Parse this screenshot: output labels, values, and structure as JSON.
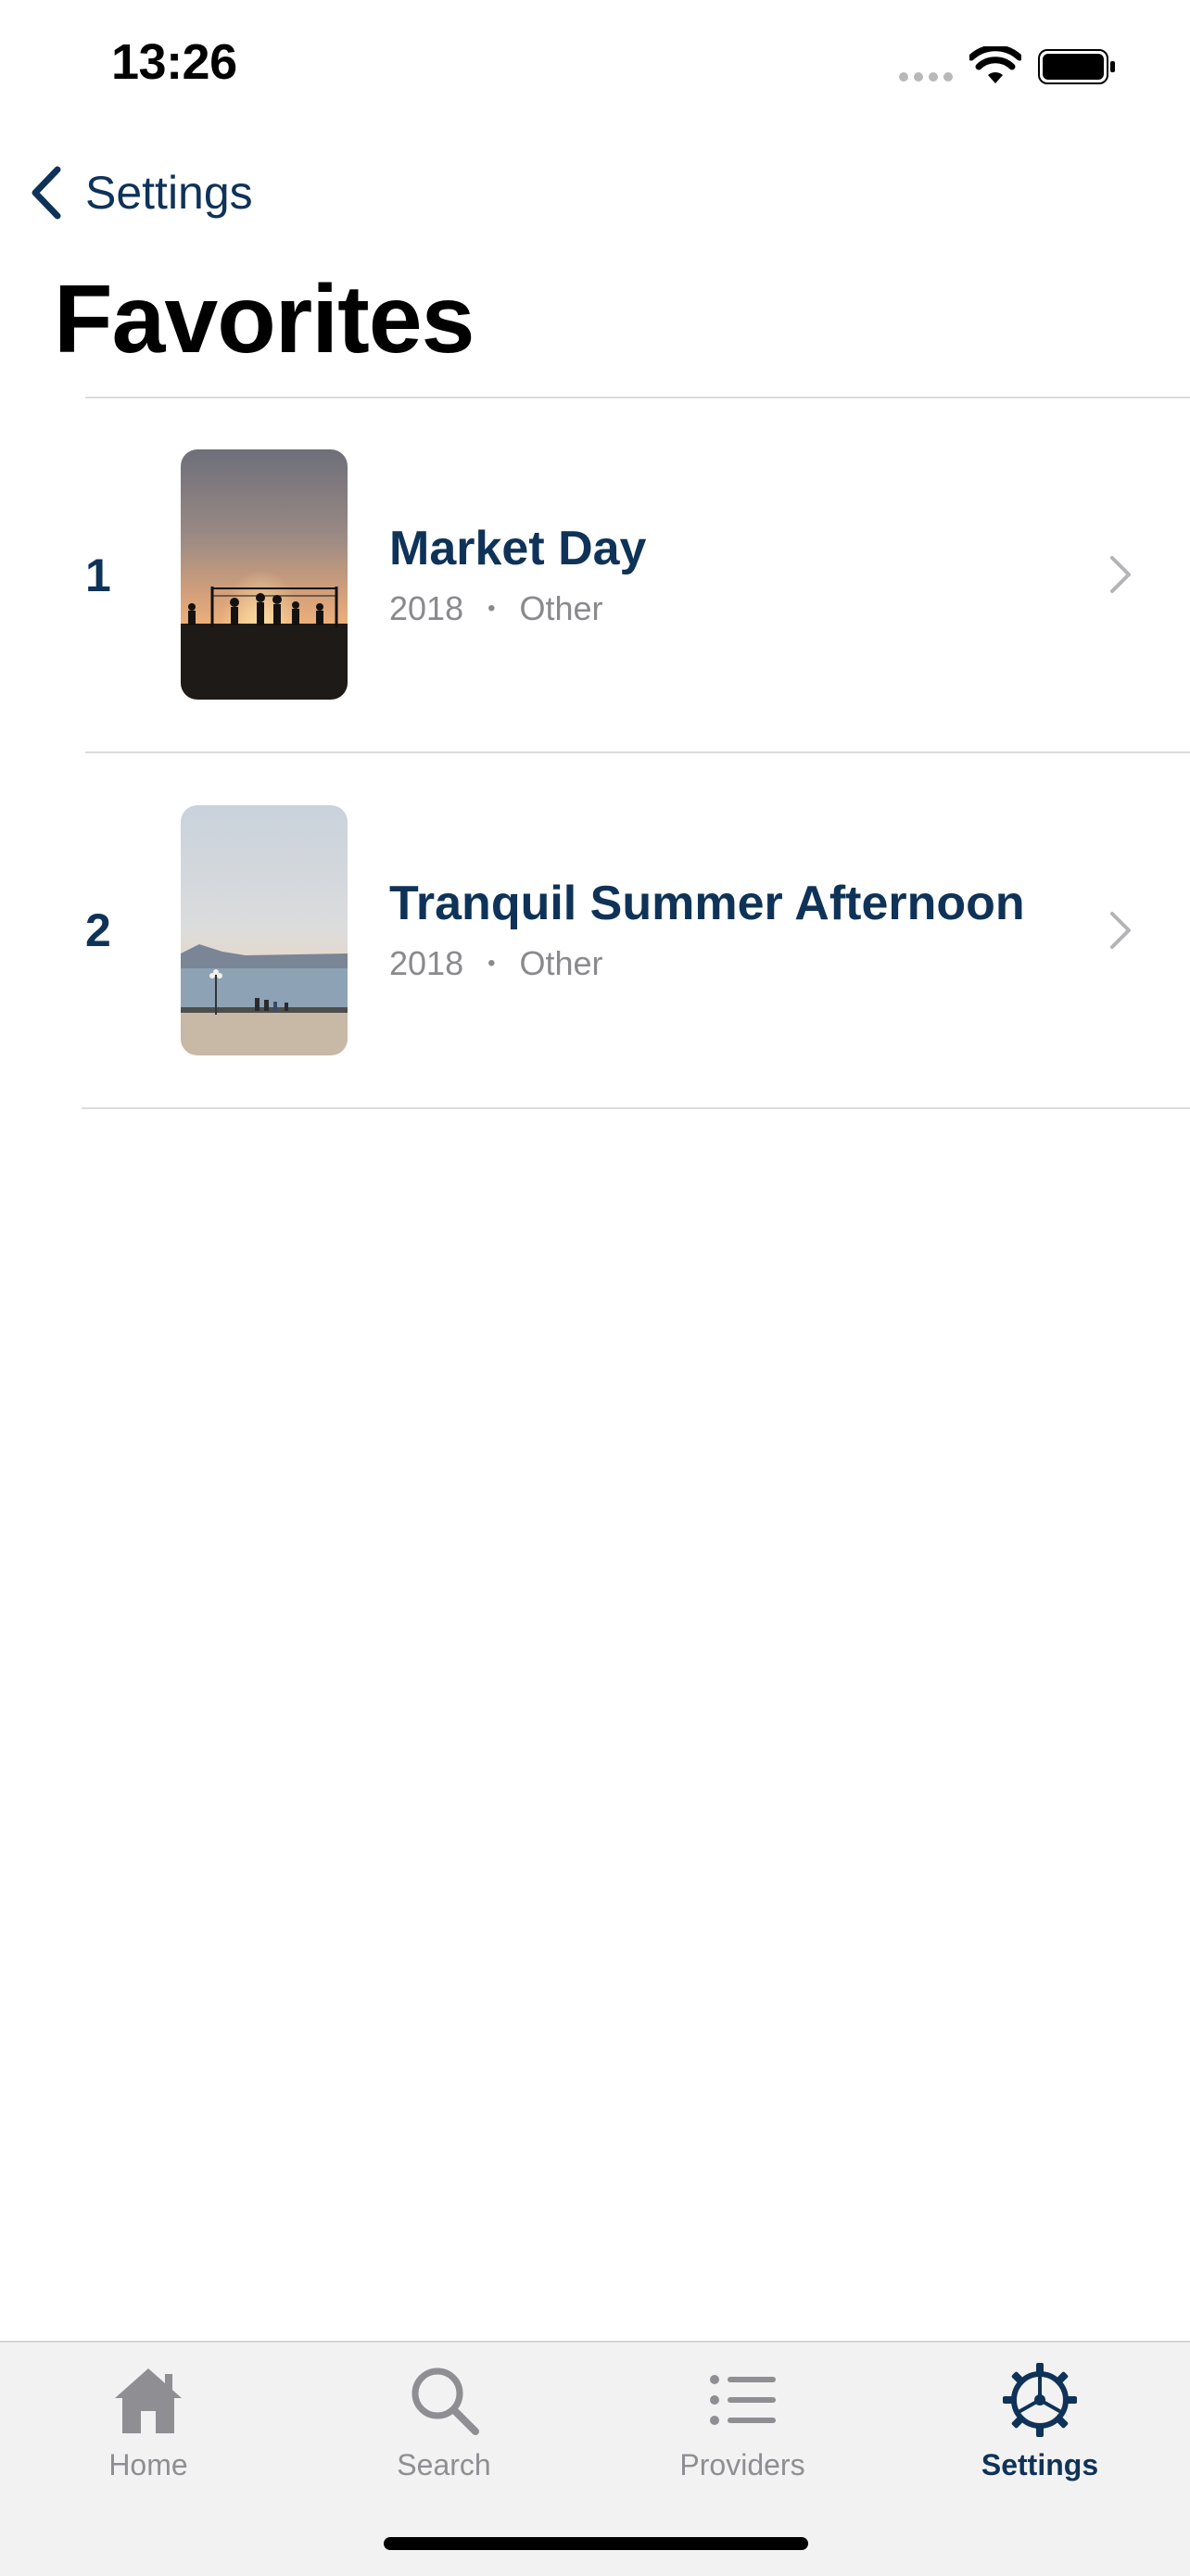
{
  "status_bar": {
    "time": "13:26"
  },
  "nav": {
    "back_label": "Settings",
    "title": "Favorites"
  },
  "favorites": [
    {
      "rank": "1",
      "title": "Market Day",
      "year": "2018",
      "separator": "•",
      "category": "Other",
      "thumbnail": "sunset-beach-volleyball-photo"
    },
    {
      "rank": "2",
      "title": "Tranquil Summer Afternoon",
      "year": "2018",
      "separator": "•",
      "category": "Other",
      "thumbnail": "seaside-promenade-photo"
    }
  ],
  "tab_bar": {
    "tabs": [
      {
        "label": "Home",
        "icon": "house-icon",
        "active": false
      },
      {
        "label": "Search",
        "icon": "magnifier-icon",
        "active": false
      },
      {
        "label": "Providers",
        "icon": "list-icon",
        "active": false
      },
      {
        "label": "Settings",
        "icon": "gear-icon",
        "active": true
      }
    ]
  },
  "colors": {
    "accent": "#0f3358",
    "secondary_text": "#8a8a8e",
    "tab_inactive": "#8e8e93",
    "tab_bar_bg": "#f2f2f2",
    "divider": "#dcdcdc"
  }
}
